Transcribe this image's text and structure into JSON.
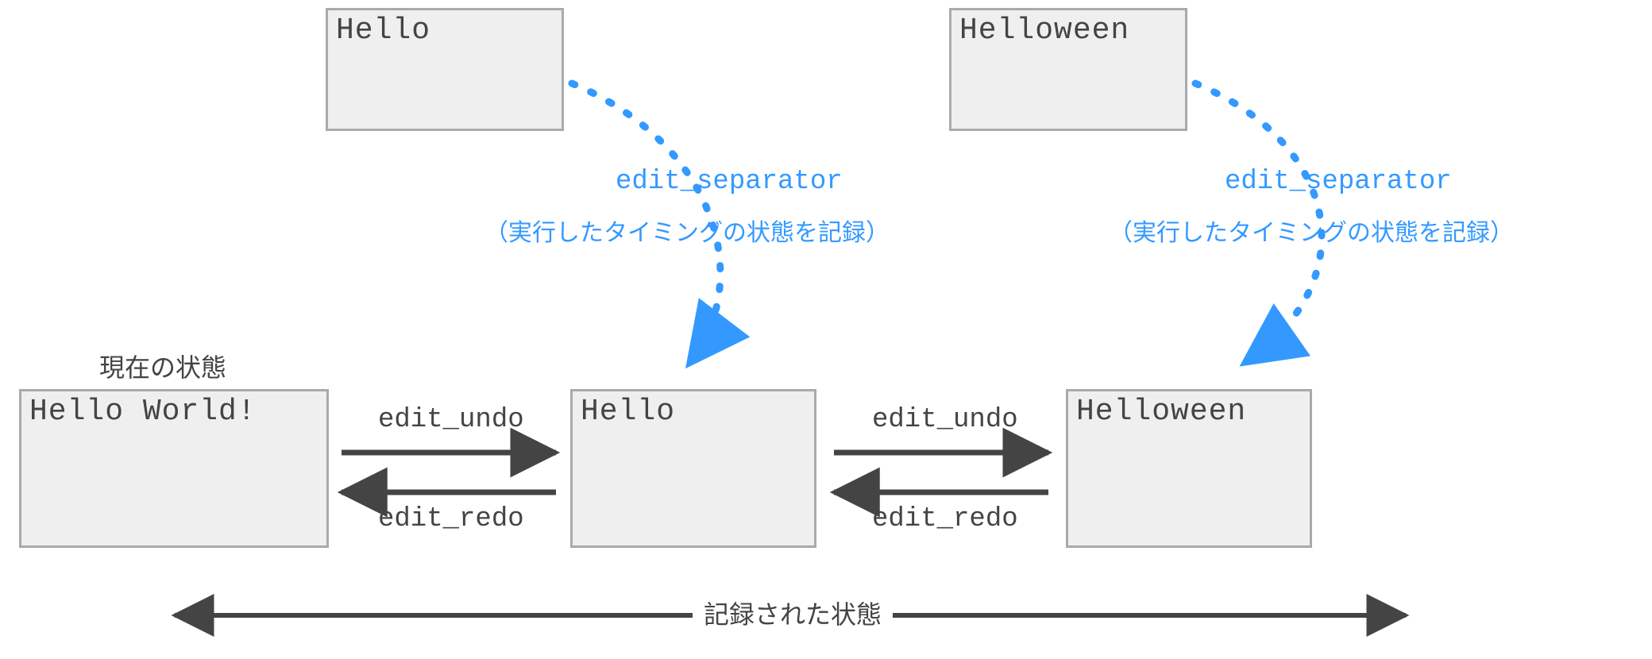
{
  "states": {
    "top_left": {
      "text": "Hello"
    },
    "top_right": {
      "text": "Helloween"
    },
    "bottom_left": {
      "text": "Hello World!"
    },
    "bottom_center": {
      "text": "Hello"
    },
    "bottom_right": {
      "text": "Helloween"
    }
  },
  "labels": {
    "current_state": "現在の状態",
    "recorded_state": "記録された状態",
    "undo1": "edit_undo",
    "redo1": "edit_redo",
    "undo2": "edit_undo",
    "redo2": "edit_redo",
    "sep1_title": "edit_separator",
    "sep1_note": "（実行したタイミングの状態を記録）",
    "sep2_title": "edit_separator",
    "sep2_note": "（実行したタイミングの状態を記録）"
  },
  "colors": {
    "box_bg": "#efefef",
    "box_border": "#aaaaaa",
    "text_grey": "#444444",
    "accent_blue": "#3399ff",
    "arrow_grey": "#444444"
  }
}
